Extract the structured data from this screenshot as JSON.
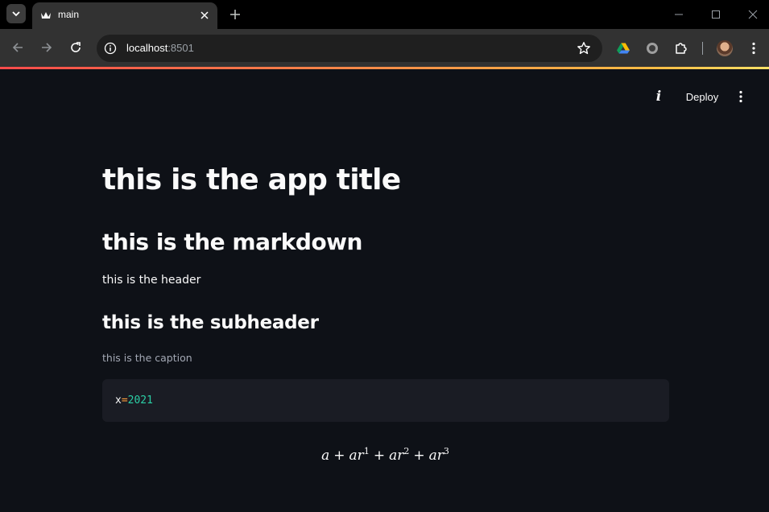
{
  "browser": {
    "tab_title": "main",
    "url_host": "localhost",
    "url_port": ":8501"
  },
  "streamlit_header": {
    "deploy_label": "Deploy"
  },
  "content": {
    "title": "this is the app title",
    "markdown": "this is the markdown",
    "header": "this is the header",
    "subheader": "this is the subheader",
    "caption": "this is the caption",
    "code": {
      "var": "x",
      "op": "=",
      "value": "2021"
    },
    "latex": {
      "t1": "a",
      "op1": "+",
      "t2": "ar",
      "e2": "1",
      "op2": "+",
      "t3": "ar",
      "e3": "2",
      "op3": "+",
      "t4": "ar",
      "e4": "3"
    }
  },
  "colors": {
    "background": "#0e1117",
    "code_background": "#1a1c24",
    "accent_start": "#ff4b4b",
    "accent_end": "#ffe066",
    "code_number": "#2bcfa6",
    "code_operator": "#ff9e3b"
  }
}
